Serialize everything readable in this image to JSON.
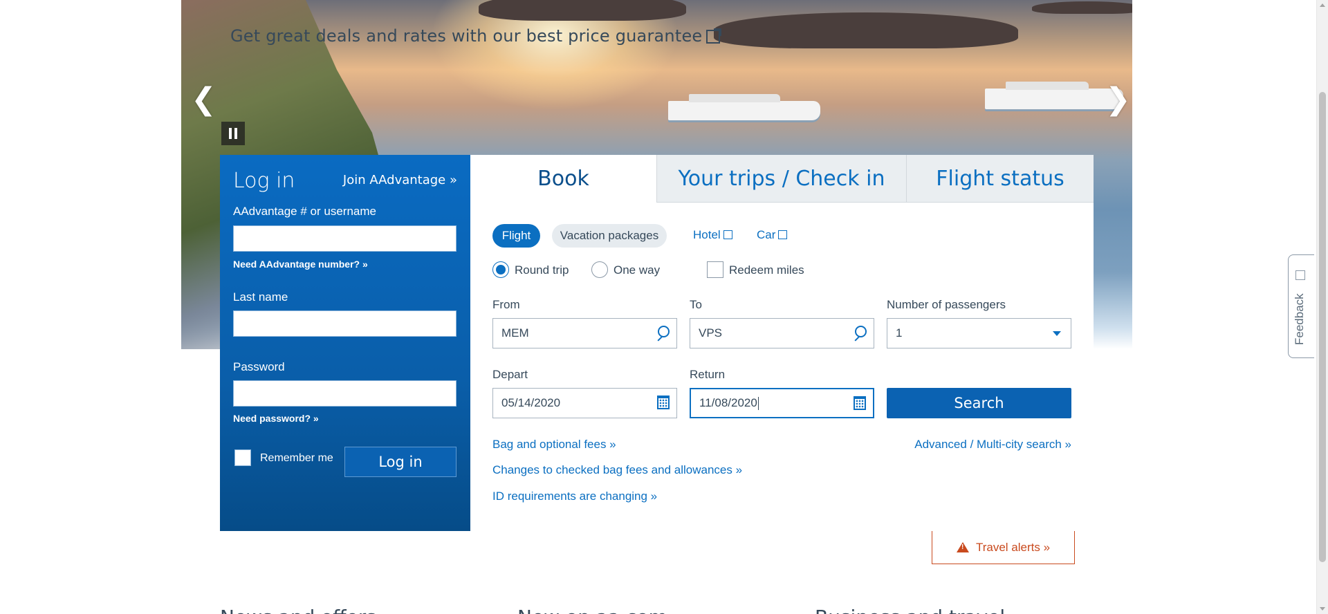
{
  "hero": {
    "promo_text": "Get great deals and rates with our best price guarantee",
    "prev_arrow": "❮",
    "next_arrow": "❯"
  },
  "login": {
    "title": "Log in",
    "join_link": "Join AAdvantage »",
    "username_label": "AAdvantage # or username",
    "username_value": "",
    "need_number": "Need AAdvantage number? »",
    "lastname_label": "Last name",
    "lastname_value": "",
    "password_label": "Password",
    "password_value": "",
    "need_password": "Need password? »",
    "remember_label": "Remember me",
    "login_button": "Log in"
  },
  "tabs": [
    {
      "label": "Book",
      "active": true
    },
    {
      "label": "Your trips / Check in",
      "active": false
    },
    {
      "label": "Flight status",
      "active": false
    }
  ],
  "book": {
    "types": {
      "flight": "Flight",
      "vacation": "Vacation packages",
      "hotel": "Hotel",
      "car": "Car"
    },
    "trip": {
      "round": "Round trip",
      "one_way": "One way",
      "selected": "Round trip",
      "redeem": "Redeem miles"
    },
    "from_label": "From",
    "from_value": "MEM",
    "to_label": "To",
    "to_value": "VPS",
    "passengers_label": "Number of passengers",
    "passengers_value": "1",
    "depart_label": "Depart",
    "depart_value": "05/14/2020",
    "return_label": "Return",
    "return_value": "11/08/2020",
    "search_button": "Search",
    "links": {
      "bag_fees": "Bag and optional fees »",
      "advanced": "Advanced / Multi-city search »",
      "checked_bag": "Changes to checked bag fees and allowances »",
      "id_req": "ID requirements are changing »"
    }
  },
  "travel_alerts": "Travel alerts »",
  "feedback": "Feedback",
  "bottom_headings": [
    "News and offers",
    "New on aa.com",
    "Business and travel"
  ],
  "colors": {
    "brand_blue": "#0b6fc1",
    "panel_blue": "#0a5ea9",
    "alert_orange": "#c94a1e",
    "text": "#36495a"
  }
}
